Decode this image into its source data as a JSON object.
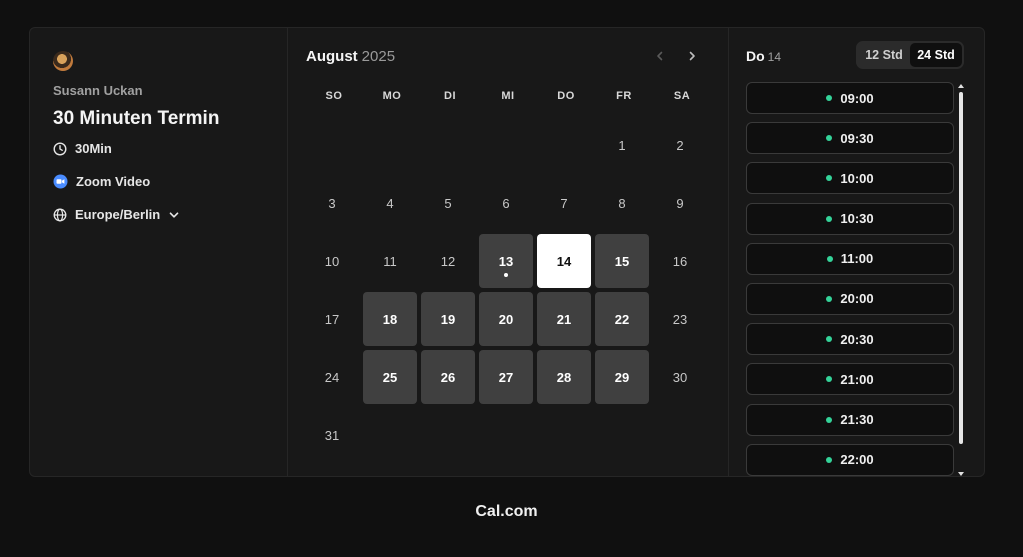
{
  "sidebar": {
    "host": "Susann Uckan",
    "event_title": "30 Minuten Termin",
    "duration": "30Min",
    "location": "Zoom Video",
    "timezone": "Europe/Berlin"
  },
  "calendar": {
    "month": "August",
    "year": "2025",
    "weekdays": [
      "SO",
      "MO",
      "DI",
      "MI",
      "DO",
      "FR",
      "SA"
    ],
    "days": [
      {
        "label": "",
        "state": "empty"
      },
      {
        "label": "",
        "state": "empty"
      },
      {
        "label": "",
        "state": "empty"
      },
      {
        "label": "",
        "state": "empty"
      },
      {
        "label": "",
        "state": "empty"
      },
      {
        "label": "1",
        "state": "plain"
      },
      {
        "label": "2",
        "state": "plain"
      },
      {
        "label": "3",
        "state": "plain"
      },
      {
        "label": "4",
        "state": "plain"
      },
      {
        "label": "5",
        "state": "plain"
      },
      {
        "label": "6",
        "state": "plain"
      },
      {
        "label": "7",
        "state": "plain"
      },
      {
        "label": "8",
        "state": "plain"
      },
      {
        "label": "9",
        "state": "plain"
      },
      {
        "label": "10",
        "state": "plain"
      },
      {
        "label": "11",
        "state": "plain"
      },
      {
        "label": "12",
        "state": "plain"
      },
      {
        "label": "13",
        "state": "avail",
        "today": true
      },
      {
        "label": "14",
        "state": "selected"
      },
      {
        "label": "15",
        "state": "avail"
      },
      {
        "label": "16",
        "state": "plain"
      },
      {
        "label": "17",
        "state": "plain"
      },
      {
        "label": "18",
        "state": "avail"
      },
      {
        "label": "19",
        "state": "avail"
      },
      {
        "label": "20",
        "state": "avail"
      },
      {
        "label": "21",
        "state": "avail"
      },
      {
        "label": "22",
        "state": "avail"
      },
      {
        "label": "23",
        "state": "plain"
      },
      {
        "label": "24",
        "state": "plain"
      },
      {
        "label": "25",
        "state": "avail"
      },
      {
        "label": "26",
        "state": "avail"
      },
      {
        "label": "27",
        "state": "avail"
      },
      {
        "label": "28",
        "state": "avail"
      },
      {
        "label": "29",
        "state": "avail"
      },
      {
        "label": "30",
        "state": "plain"
      },
      {
        "label": "31",
        "state": "plain"
      }
    ]
  },
  "slots": {
    "day_name": "Do",
    "day_number": "14",
    "format_options": [
      "12 Std",
      "24 Std"
    ],
    "active_format": "24 Std",
    "times": [
      "09:00",
      "09:30",
      "10:00",
      "10:30",
      "11:00",
      "20:00",
      "20:30",
      "21:00",
      "21:30",
      "22:00"
    ],
    "available_color": "#34d399"
  },
  "footer": {
    "brand": "Cal.com"
  }
}
